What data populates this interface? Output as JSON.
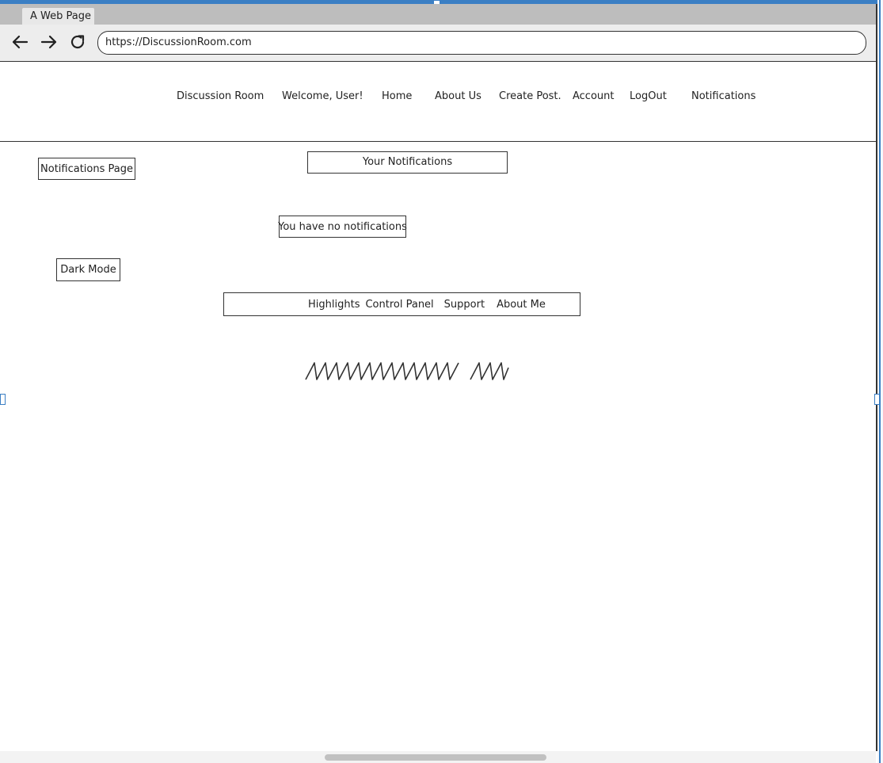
{
  "browser": {
    "tab_title": "A Web Page",
    "url": "https://DiscussionRoom.com",
    "icons": {
      "back": "arrow-left-icon",
      "forward": "arrow-right-icon",
      "reload": "reload-icon"
    }
  },
  "nav": {
    "brand": "Discussion Room",
    "welcome": "Welcome, User!",
    "home": "Home",
    "about_us": "About Us",
    "create_post": "Create Post.",
    "account": "Account",
    "logout": "LogOut",
    "notifications": "Notifications"
  },
  "page": {
    "label": "Notifications Page",
    "heading": "Your Notifications",
    "empty_message": "You have no notifications",
    "dark_mode": "Dark Mode"
  },
  "footer": {
    "highlights": "Highlights",
    "control_panel": "Control Panel",
    "support": "Support",
    "about_me": "About Me"
  },
  "colors": {
    "accent": "#3b7fc4",
    "tabbar": "#bdbdbd",
    "toolbar": "#ededed",
    "stroke": "#333333"
  }
}
